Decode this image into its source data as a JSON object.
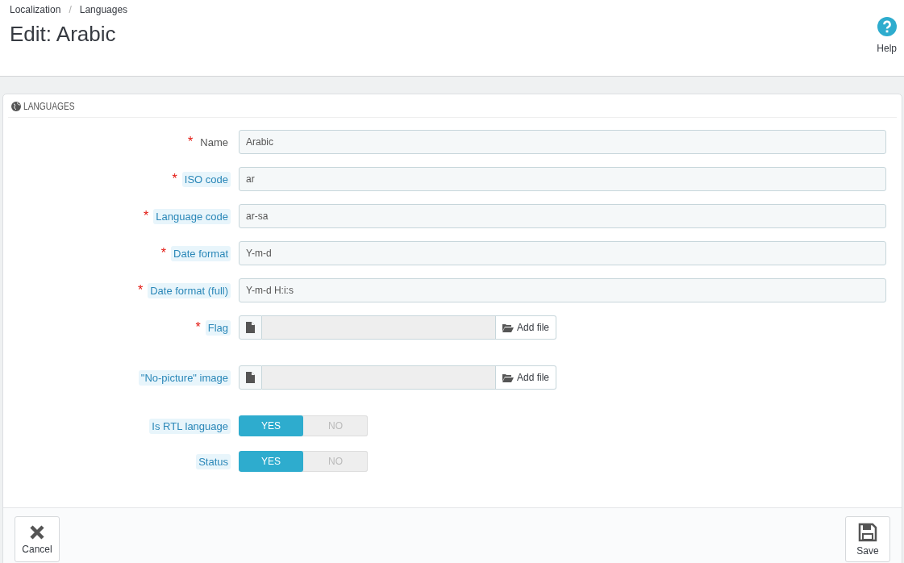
{
  "breadcrumb": [
    "Localization",
    "Languages"
  ],
  "breadcrumb_separator": "/",
  "title": "Edit: Arabic",
  "help": {
    "label": "Help"
  },
  "panel": {
    "heading": "LANGUAGES",
    "fields": [
      {
        "kind": "text",
        "label": "Name",
        "required_mark": "*",
        "has_hint": false,
        "value": "Arabic"
      },
      {
        "kind": "text",
        "label": "ISO code",
        "required_mark": "*",
        "has_hint": true,
        "value": "ar"
      },
      {
        "kind": "text",
        "label": "Language code",
        "required_mark": "*",
        "has_hint": true,
        "value": "ar-sa"
      },
      {
        "kind": "text",
        "label": "Date format",
        "required_mark": "*",
        "has_hint": true,
        "value": "Y-m-d"
      },
      {
        "kind": "text",
        "label": "Date format (full)",
        "required_mark": "*",
        "has_hint": true,
        "value": "Y-m-d H:i:s"
      },
      {
        "kind": "file",
        "label": "Flag",
        "required_mark": "*",
        "has_hint": true,
        "button": "Add file"
      },
      {
        "kind": "file",
        "label": "\"No-picture\" image",
        "has_hint": true,
        "button": "Add file"
      },
      {
        "kind": "switch",
        "label": "Is RTL language",
        "has_hint": true,
        "options": [
          {
            "label": "YES",
            "selected": true
          },
          {
            "label": "NO",
            "selected": false
          }
        ]
      },
      {
        "kind": "switch",
        "label": "Status",
        "has_hint": true,
        "options": [
          {
            "label": "YES",
            "selected": true
          },
          {
            "label": "NO",
            "selected": false
          }
        ]
      }
    ],
    "footer": {
      "cancel": "Cancel",
      "save": "Save"
    }
  }
}
